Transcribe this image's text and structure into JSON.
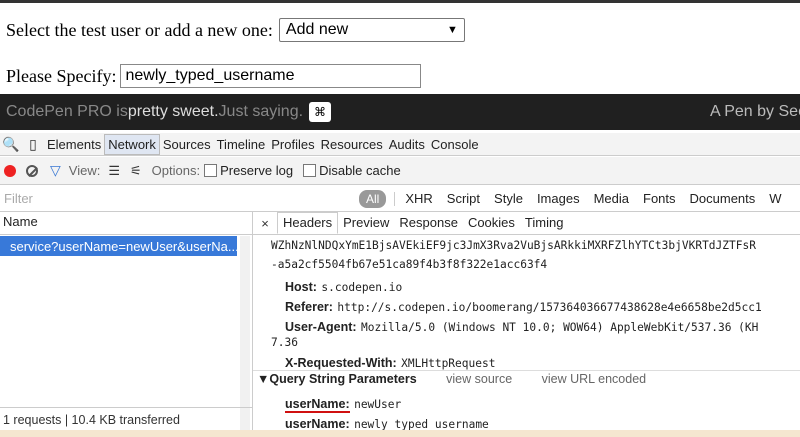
{
  "page": {
    "select_prompt": "Select the test user or add a new one:",
    "select_value": "Add new",
    "specify_label": "Please Specify:",
    "specify_value": "newly_typed_username"
  },
  "codepen_bar": {
    "text_a": "CodePen PRO is ",
    "text_b": "pretty sweet.",
    "text_c": " Just saying.",
    "kbd": "⌘",
    "right_text": "A Pen by Sec"
  },
  "devtools": {
    "tabs": [
      "Elements",
      "Network",
      "Sources",
      "Timeline",
      "Profiles",
      "Resources",
      "Audits",
      "Console"
    ],
    "active_tab": "Network",
    "toolbar": {
      "view_label": "View:",
      "options_label": "Options:",
      "preserve_log": "Preserve log",
      "disable_cache": "Disable cache"
    },
    "filter": {
      "placeholder": "Filter",
      "all": "All",
      "types": [
        "XHR",
        "Script",
        "Style",
        "Images",
        "Media",
        "Fonts",
        "Documents",
        "W"
      ]
    },
    "left": {
      "name_header": "Name",
      "request": "service?userName=newUser&userNa...",
      "footer": "1 requests | 10.4 KB transferred"
    },
    "right": {
      "tabs": [
        "Headers",
        "Preview",
        "Response",
        "Cookies",
        "Timing"
      ],
      "close": "×",
      "cookie_line1": "WZhNzNlNDQxYmE1BjsAVEkiEF9jc3JmX3Rva2VuBjsARkkiMXRFZlhYTCt3bjVKRTdJZTFsR",
      "cookie_line2": "-a5a2cf5504fb67e51ca89f4b3f8f322e1acc63f4",
      "headers": [
        {
          "key": "Host:",
          "value": "s.codepen.io"
        },
        {
          "key": "Referer:",
          "value": "http://s.codepen.io/boomerang/157364036677438628e4e6658be2d5cc1"
        },
        {
          "key": "User-Agent:",
          "value": "Mozilla/5.0 (Windows NT 10.0; WOW64) AppleWebKit/537.36 (KH"
        },
        {
          "key": "",
          "value": "7.36"
        },
        {
          "key": "X-Requested-With:",
          "value": "XMLHttpRequest"
        }
      ],
      "qs_title": "Query String Parameters",
      "qs_view_source": "view source",
      "qs_view_url": "view URL encoded",
      "params": [
        {
          "key": "userName:",
          "value": "newUser"
        },
        {
          "key": "userName:",
          "value": "newly_typed_username"
        }
      ]
    }
  }
}
